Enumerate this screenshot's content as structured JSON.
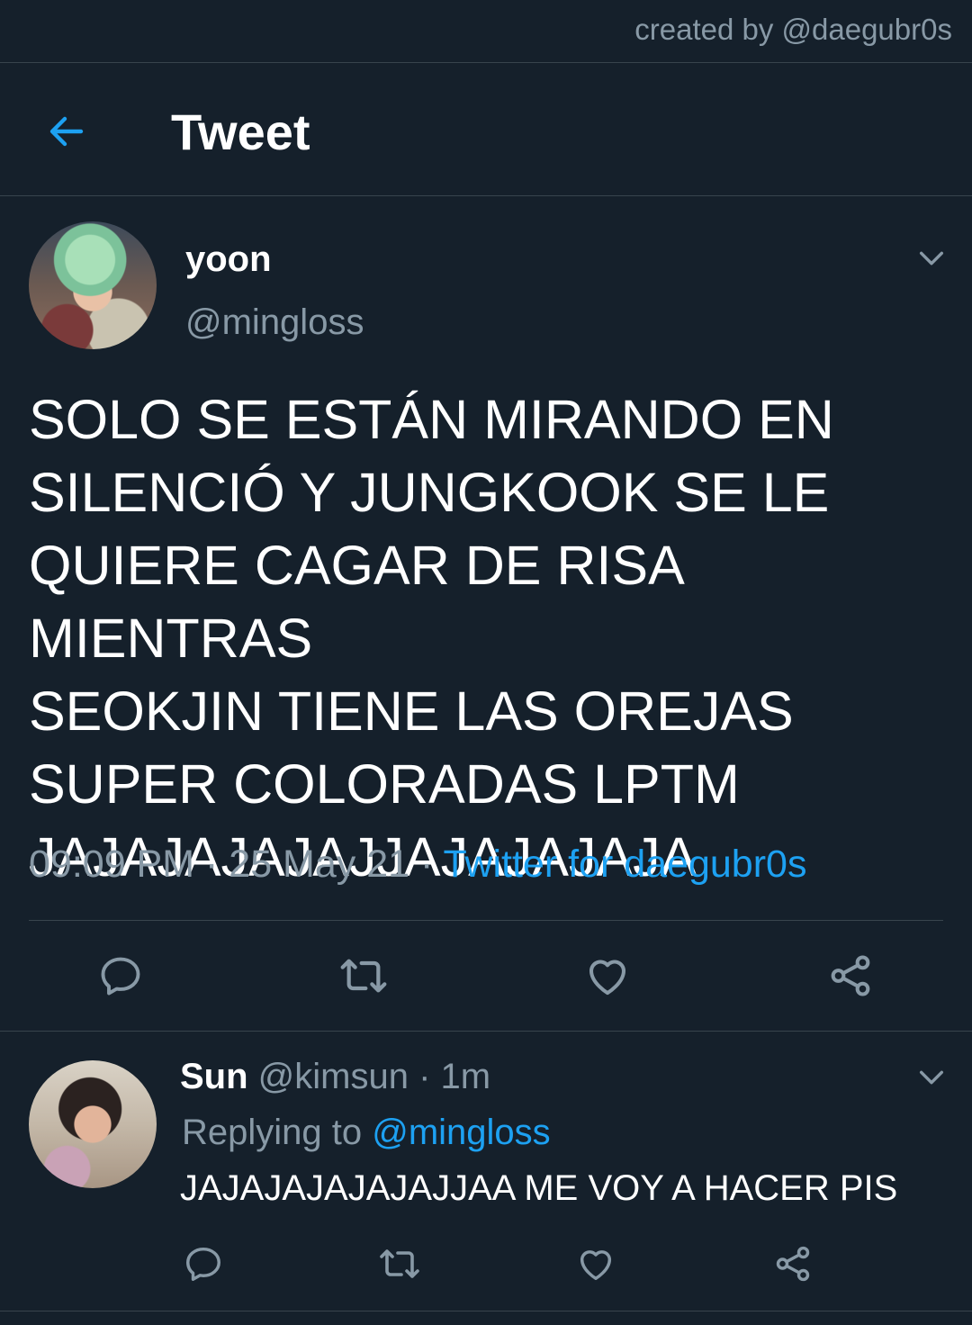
{
  "watermark": "created by @daegubr0s",
  "header": {
    "title": "Tweet"
  },
  "tweet": {
    "name": "yoon",
    "handle": "@mingloss",
    "text": "SOLO SE ESTÁN MIRANDO EN\nSILENCIÓ Y JUNGKOOK SE LE\nQUIERE CAGAR DE RISA MIENTRAS\nSEOKJIN TIENE LAS OREJAS\nSUPER COLORADAS LPTM\nJAJAJAJAJAJJAJAJAJAJA",
    "time": "09:09 PM",
    "date": "25 May 21",
    "source": "Twitter for daegubr0s",
    "separator": " · "
  },
  "reply": {
    "name": "Sun",
    "handle": "@kimsun",
    "time": "1m",
    "separator": " · ",
    "replying_prefix": "Replying to ",
    "replying_to": "@mingloss",
    "text": "JAJAJAJAJAJAJJAA ME VOY A HACER PIS"
  },
  "icons": {
    "back": "arrow-left-icon",
    "reply": "comment-icon",
    "retweet": "retweet-icon",
    "like": "heart-icon",
    "share": "share-icon",
    "more": "chevron-down-icon"
  },
  "colors": {
    "background": "#15202b",
    "divider": "#38444d",
    "accent": "#1da1f2",
    "secondary_text": "#8899a6"
  }
}
